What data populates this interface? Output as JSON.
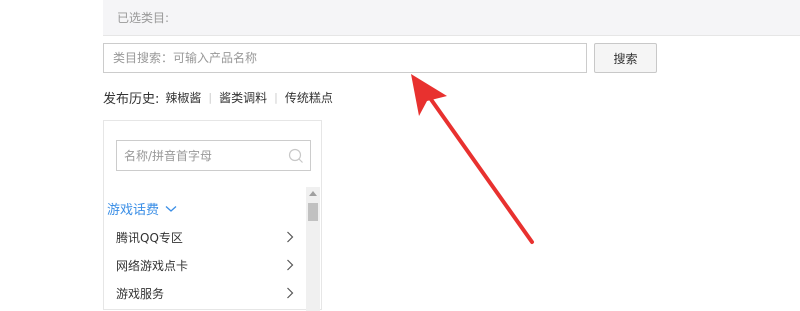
{
  "selected_category": {
    "label": "已选类目:"
  },
  "search": {
    "placeholder": "类目搜索：可输入产品名称",
    "button_label": "搜索"
  },
  "history": {
    "title": "发布历史:",
    "items": [
      "辣椒酱",
      "酱类调料",
      "传统糕点"
    ]
  },
  "category_panel": {
    "search_placeholder": "名称/拼音首字母",
    "heading": "游戏话费",
    "items": [
      {
        "label": "腾讯QQ专区"
      },
      {
        "label": "网络游戏点卡"
      },
      {
        "label": "游戏服务"
      }
    ]
  },
  "colors": {
    "accent_blue": "#3a8ee6",
    "arrow_red": "#e8312f"
  }
}
